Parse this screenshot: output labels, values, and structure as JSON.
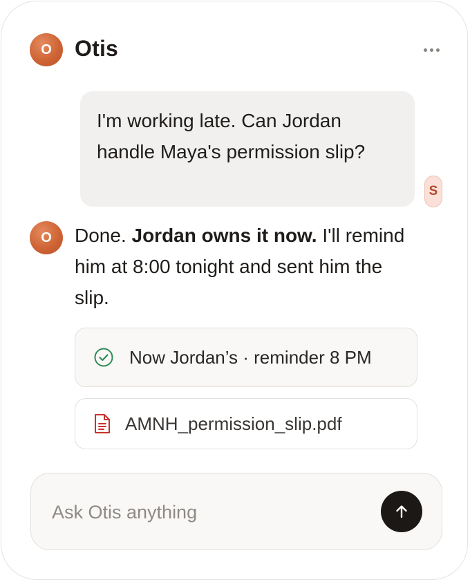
{
  "header": {
    "avatar_letter": "O",
    "title": "Otis",
    "more_icon": "more-horizontal-icon"
  },
  "messages": {
    "user": {
      "text": "I'm working late. Can Jordan handle Maya's permission slip?",
      "avatar_letter": "S"
    },
    "assistant": {
      "avatar_letter": "O",
      "text_before": "Done.",
      "text_bold": "Jordan owns it now.",
      "text_after": "I'll remind him at 8:00 tonight and sent him the slip."
    }
  },
  "status_card": {
    "icon": "check-circle-icon",
    "text": "Now Jordan’s · reminder 8 PM"
  },
  "attachment": {
    "icon": "pdf-file-icon",
    "filename": "AMNH_permission_slip.pdf"
  },
  "composer": {
    "placeholder": "Ask Otis anything",
    "value": "",
    "send_icon": "arrow-up-icon"
  },
  "colors": {
    "accent": "#cf6435",
    "success": "#2f8a56",
    "pdf": "#c8322c",
    "send_button": "#1c1816"
  }
}
